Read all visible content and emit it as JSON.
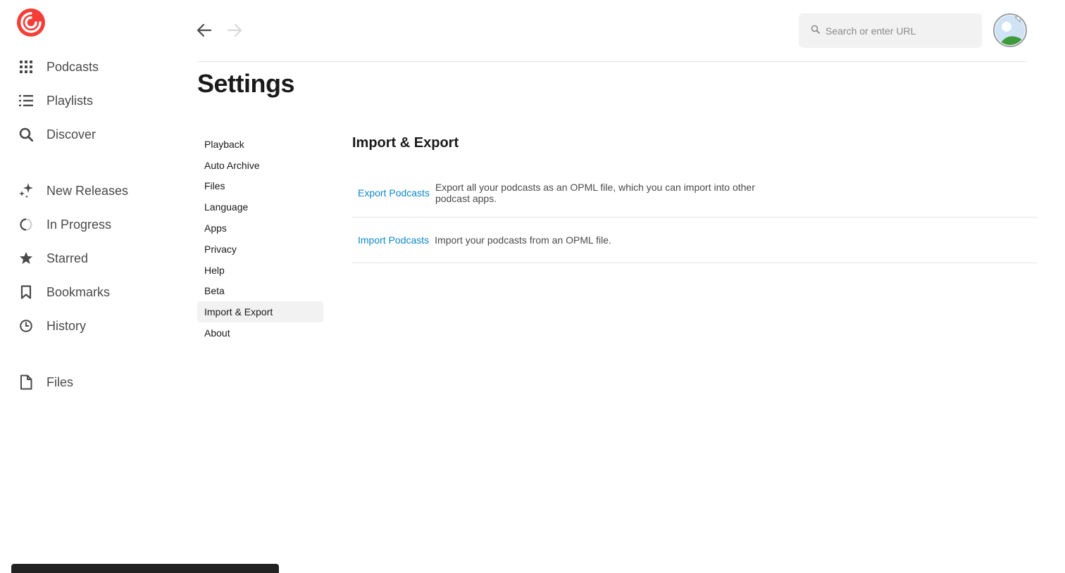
{
  "sidebar": {
    "items": [
      {
        "label": "Podcasts",
        "icon": "grid-icon"
      },
      {
        "label": "Playlists",
        "icon": "list-icon"
      },
      {
        "label": "Discover",
        "icon": "search-icon"
      },
      {
        "label": "New Releases",
        "icon": "sparkle-icon"
      },
      {
        "label": "In Progress",
        "icon": "progress-circle-icon"
      },
      {
        "label": "Starred",
        "icon": "star-icon"
      },
      {
        "label": "Bookmarks",
        "icon": "bookmark-icon"
      },
      {
        "label": "History",
        "icon": "clock-icon"
      },
      {
        "label": "Files",
        "icon": "file-icon"
      }
    ]
  },
  "header": {
    "search_placeholder": "Search or enter URL"
  },
  "page": {
    "title": "Settings"
  },
  "settings_menu": {
    "items": [
      "Playback",
      "Auto Archive",
      "Files",
      "Language",
      "Apps",
      "Privacy",
      "Help",
      "Beta",
      "Import & Export",
      "About"
    ],
    "active": "Import & Export"
  },
  "section": {
    "title": "Import & Export",
    "rows": [
      {
        "link": "Export Podcasts",
        "description": "Export all your podcasts as an OPML file, which you can import into other podcast apps."
      },
      {
        "link": "Import Podcasts",
        "description": "Import your podcasts from an OPML file."
      }
    ]
  },
  "colors": {
    "brand": "#f43e37",
    "link": "#0c89c8",
    "active_bg": "#f2f2f2"
  }
}
